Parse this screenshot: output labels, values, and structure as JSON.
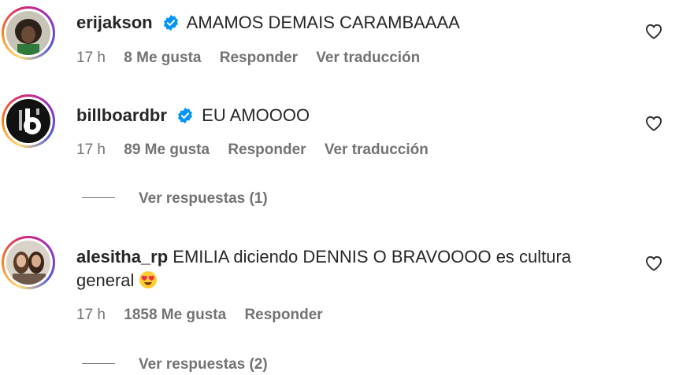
{
  "comments": [
    {
      "username": "erijakson",
      "text": "AMAMOS DEMAIS CARAMBAAAA",
      "time": "17 h",
      "likes": "8 Me gusta",
      "reply": "Responder",
      "translate": "Ver traducción"
    },
    {
      "username": "billboardbr",
      "text": "EU AMOOOO",
      "time": "17 h",
      "likes": "89 Me gusta",
      "reply": "Responder",
      "translate": "Ver traducción",
      "view_replies": "Ver respuestas (1)"
    },
    {
      "username": "alesitha_rp",
      "text_line1": "EMILIA diciendo DENNIS O BRAVOOOO es cultura",
      "text_line2": "general",
      "time": "17 h",
      "likes": "1858 Me gusta",
      "reply": "Responder",
      "view_replies": "Ver respuestas (2)"
    }
  ],
  "icons": {
    "verified": "verified-badge-icon",
    "heart": "heart-outline-icon",
    "emoji": "heart-eyes-emoji"
  },
  "colors": {
    "verified_blue": "#0095f6",
    "meta_gray": "#737373",
    "text": "#262626"
  }
}
